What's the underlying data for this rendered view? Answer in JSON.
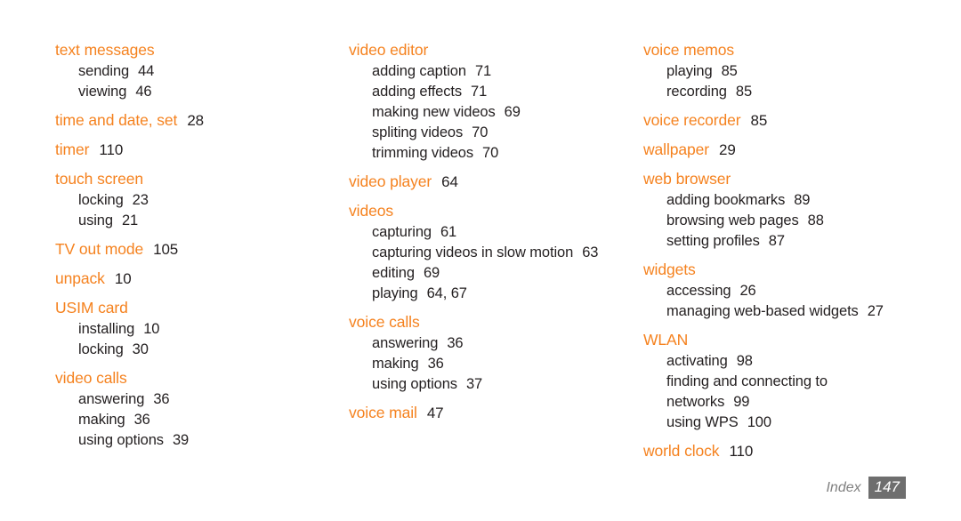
{
  "document": {
    "kind": "index-page",
    "background_color": "#FFFFFF",
    "heading_color": "#F5821F",
    "body_color": "#231F20",
    "footer_label_color": "#808080",
    "footer_badge_color": "#6E6E6E"
  },
  "columns": [
    {
      "id": "column-1",
      "entries": [
        {
          "heading": "text messages",
          "page": "",
          "subs": [
            {
              "label": "sending",
              "page": "44"
            },
            {
              "label": "viewing",
              "page": "46"
            }
          ]
        },
        {
          "heading": "time and date, set",
          "page": "28",
          "subs": []
        },
        {
          "heading": "timer",
          "page": "110",
          "subs": []
        },
        {
          "heading": "touch screen",
          "page": "",
          "subs": [
            {
              "label": "locking",
              "page": "23"
            },
            {
              "label": "using",
              "page": "21"
            }
          ]
        },
        {
          "heading": "TV out mode",
          "page": "105",
          "subs": []
        },
        {
          "heading": "unpack",
          "page": "10",
          "subs": []
        },
        {
          "heading": "USIM card",
          "page": "",
          "subs": [
            {
              "label": "installing",
              "page": "10"
            },
            {
              "label": "locking",
              "page": "30"
            }
          ]
        },
        {
          "heading": "video calls",
          "page": "",
          "subs": [
            {
              "label": "answering",
              "page": "36"
            },
            {
              "label": "making",
              "page": "36"
            },
            {
              "label": "using options",
              "page": "39"
            }
          ]
        }
      ]
    },
    {
      "id": "column-2",
      "entries": [
        {
          "heading": "video editor",
          "page": "",
          "subs": [
            {
              "label": "adding caption",
              "page": "71"
            },
            {
              "label": "adding effects",
              "page": "71"
            },
            {
              "label": "making new videos",
              "page": "69"
            },
            {
              "label": "spliting videos",
              "page": "70"
            },
            {
              "label": "trimming videos",
              "page": "70"
            }
          ]
        },
        {
          "heading": "video player",
          "page": "64",
          "subs": []
        },
        {
          "heading": "videos",
          "page": "",
          "subs": [
            {
              "label": "capturing",
              "page": "61"
            },
            {
              "label": "capturing videos in slow motion",
              "page": "63",
              "wrap": true
            },
            {
              "label": "editing",
              "page": "69"
            },
            {
              "label": "playing",
              "page": "64, 67"
            }
          ]
        },
        {
          "heading": "voice calls",
          "page": "",
          "subs": [
            {
              "label": "answering",
              "page": "36"
            },
            {
              "label": "making",
              "page": "36"
            },
            {
              "label": "using options",
              "page": "37"
            }
          ]
        },
        {
          "heading": "voice mail",
          "page": "47",
          "subs": []
        }
      ]
    },
    {
      "id": "column-3",
      "entries": [
        {
          "heading": "voice memos",
          "page": "",
          "subs": [
            {
              "label": "playing",
              "page": "85"
            },
            {
              "label": "recording",
              "page": "85"
            }
          ]
        },
        {
          "heading": "voice recorder",
          "page": "85",
          "subs": []
        },
        {
          "heading": "wallpaper",
          "page": "29",
          "subs": []
        },
        {
          "heading": "web browser",
          "page": "",
          "subs": [
            {
              "label": "adding bookmarks",
              "page": "89"
            },
            {
              "label": "browsing web pages",
              "page": "88"
            },
            {
              "label": "setting profiles",
              "page": "87"
            }
          ]
        },
        {
          "heading": "widgets",
          "page": "",
          "subs": [
            {
              "label": "accessing",
              "page": "26"
            },
            {
              "label": "managing web-based widgets",
              "page": "27"
            }
          ]
        },
        {
          "heading": "WLAN",
          "page": "",
          "subs": [
            {
              "label": "activating",
              "page": "98"
            },
            {
              "label": "finding and connecting to networks",
              "page": "99",
              "wrap": true
            },
            {
              "label": "using WPS",
              "page": "100"
            }
          ]
        },
        {
          "heading": "world clock",
          "page": "110",
          "subs": []
        }
      ]
    }
  ],
  "footer": {
    "label": "Index",
    "page_number": "147"
  }
}
